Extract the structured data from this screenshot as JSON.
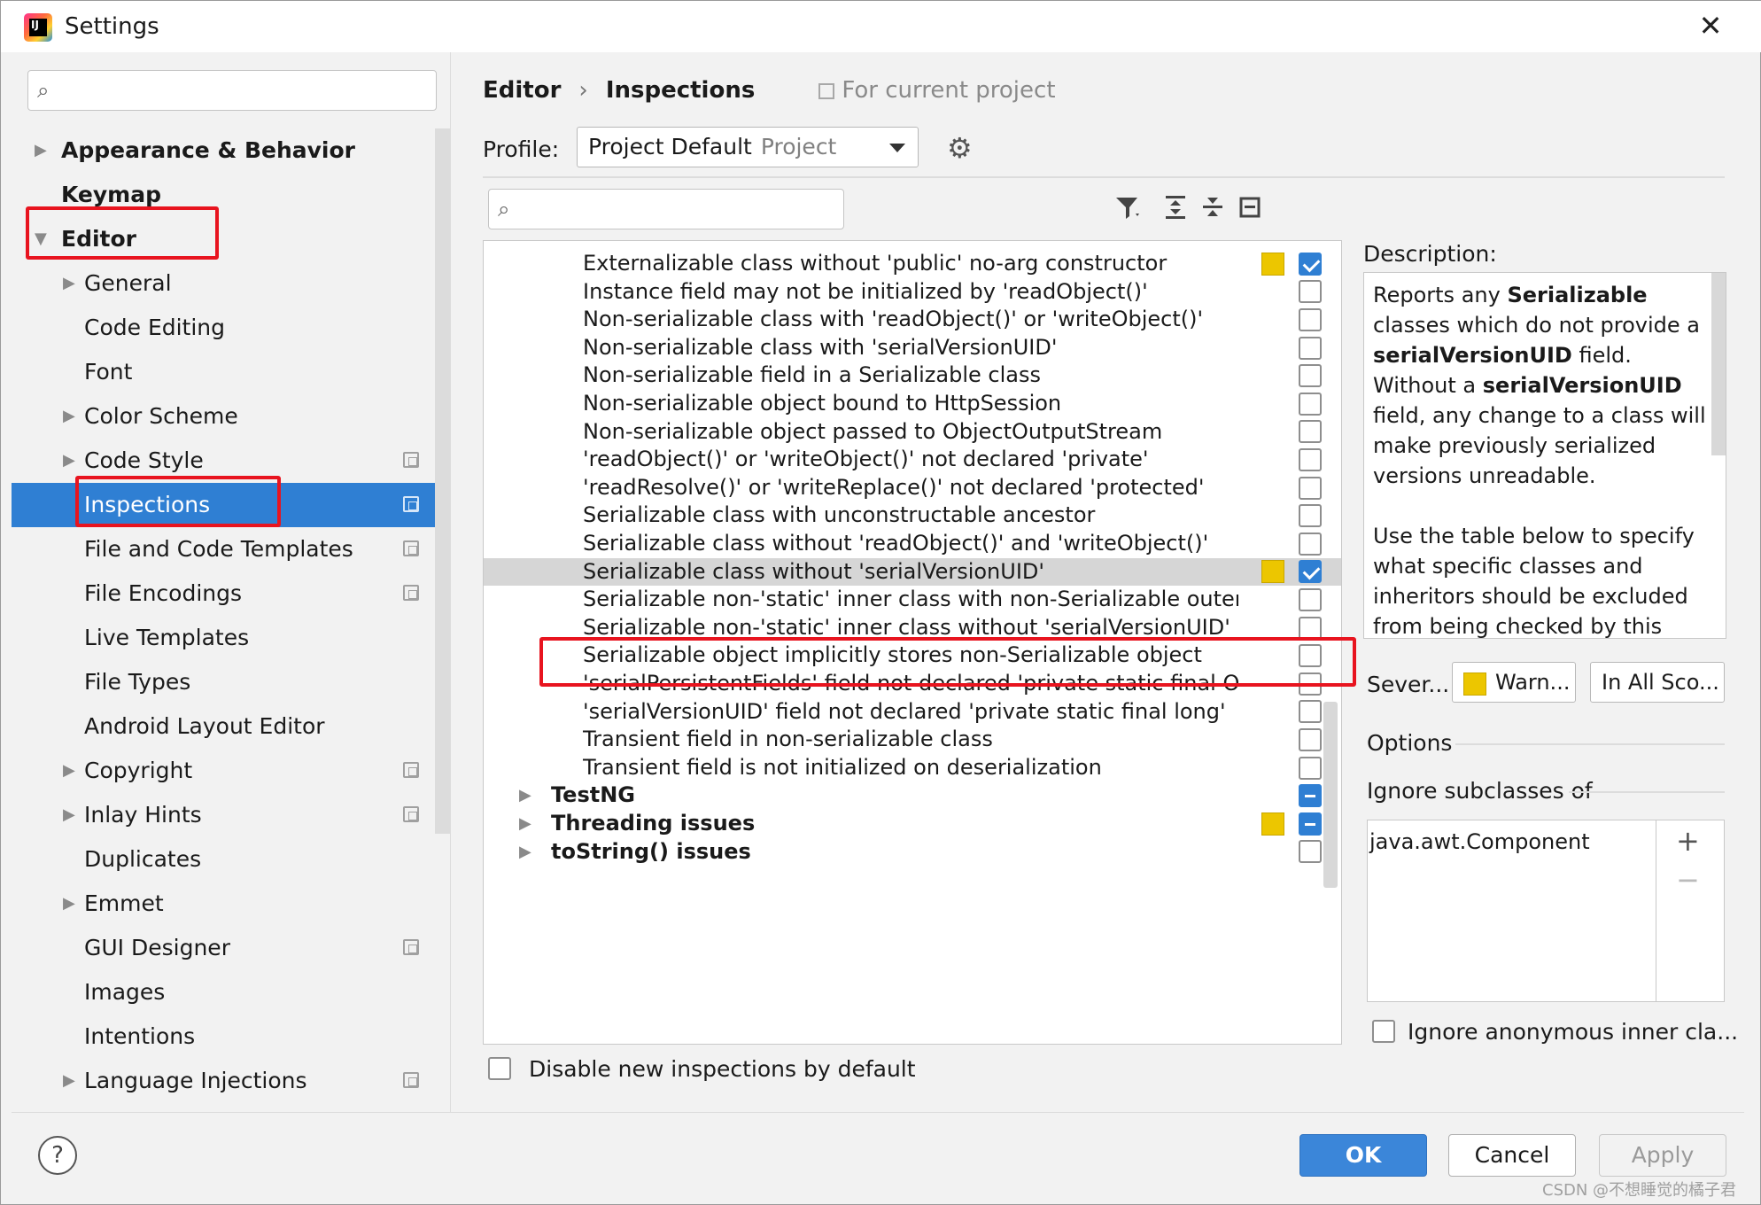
{
  "window": {
    "title": "Settings",
    "close_glyph": "✕"
  },
  "sidebar": {
    "search_placeholder": "",
    "items": [
      {
        "label": "Appearance & Behavior",
        "bold": true,
        "arrow": "▶"
      },
      {
        "label": "Keymap",
        "bold": true,
        "arrow": ""
      },
      {
        "label": "Editor",
        "bold": true,
        "arrow": "▼"
      },
      {
        "label": "General",
        "arrow": "▶"
      },
      {
        "label": "Code Editing",
        "arrow": ""
      },
      {
        "label": "Font",
        "arrow": ""
      },
      {
        "label": "Color Scheme",
        "arrow": "▶"
      },
      {
        "label": "Code Style",
        "arrow": "▶",
        "project": true
      },
      {
        "label": "Inspections",
        "arrow": "",
        "project": true,
        "selected": true
      },
      {
        "label": "File and Code Templates",
        "arrow": "",
        "project": true
      },
      {
        "label": "File Encodings",
        "arrow": "",
        "project": true
      },
      {
        "label": "Live Templates",
        "arrow": ""
      },
      {
        "label": "File Types",
        "arrow": ""
      },
      {
        "label": "Android Layout Editor",
        "arrow": ""
      },
      {
        "label": "Copyright",
        "arrow": "▶",
        "project": true
      },
      {
        "label": "Inlay Hints",
        "arrow": "▶",
        "project": true
      },
      {
        "label": "Duplicates",
        "arrow": ""
      },
      {
        "label": "Emmet",
        "arrow": "▶"
      },
      {
        "label": "GUI Designer",
        "arrow": "",
        "project": true
      },
      {
        "label": "Images",
        "arrow": ""
      },
      {
        "label": "Intentions",
        "arrow": ""
      },
      {
        "label": "Language Injections",
        "arrow": "▶",
        "project": true
      }
    ]
  },
  "main": {
    "breadcrumb": {
      "first": "Editor",
      "separator": "›",
      "second": "Inspections",
      "scope": "For current project"
    },
    "profile": {
      "label": "Profile:",
      "value": "Project Default",
      "sub": "Project"
    },
    "search_placeholder": "",
    "inspections": [
      {
        "label": "Externalizable class without 'public' no-arg constructor",
        "sev": true,
        "state": "on"
      },
      {
        "label": "Instance field may not be initialized by 'readObject()'",
        "state": "off"
      },
      {
        "label": "Non-serializable class with 'readObject()' or 'writeObject()'",
        "state": "off"
      },
      {
        "label": "Non-serializable class with 'serialVersionUID'",
        "state": "off"
      },
      {
        "label": "Non-serializable field in a Serializable class",
        "state": "off"
      },
      {
        "label": "Non-serializable object bound to HttpSession",
        "state": "off"
      },
      {
        "label": "Non-serializable object passed to ObjectOutputStream",
        "state": "off"
      },
      {
        "label": "'readObject()' or 'writeObject()' not declared 'private'",
        "state": "off"
      },
      {
        "label": "'readResolve()' or 'writeReplace()' not declared 'protected'",
        "state": "off"
      },
      {
        "label": "Serializable class with unconstructable ancestor",
        "state": "off"
      },
      {
        "label": "Serializable class without 'readObject()' and 'writeObject()'",
        "state": "off"
      },
      {
        "label": "Serializable class without 'serialVersionUID'",
        "sev": true,
        "state": "on",
        "highlight": true
      },
      {
        "label": "Serializable non-'static' inner class with non-Serializable outer class",
        "state": "off"
      },
      {
        "label": "Serializable non-'static' inner class without 'serialVersionUID'",
        "state": "off"
      },
      {
        "label": "Serializable object implicitly stores non-Serializable object",
        "state": "off"
      },
      {
        "label": "'serialPersistentFields' field not declared 'private static final ObjectStreamField[]'",
        "state": "off"
      },
      {
        "label": "'serialVersionUID' field not declared 'private static final long'",
        "state": "off"
      },
      {
        "label": "Transient field in non-serializable class",
        "state": "off"
      },
      {
        "label": "Transient field is not initialized on deserialization",
        "state": "off"
      },
      {
        "label": "TestNG",
        "group": true,
        "state": "mixed"
      },
      {
        "label": "Threading issues",
        "group": true,
        "sev": true,
        "state": "mixed"
      },
      {
        "label": "toString() issues",
        "group": true,
        "state": "off"
      }
    ],
    "disable_new_label": "Disable new inspections by default",
    "description_label": "Description:",
    "description": {
      "p1_a": "Reports any ",
      "p1_b": "Serializable",
      "p1_c": " classes which do not provide a ",
      "p1_d": "serialVersionUID",
      "p1_e": " field. Without a ",
      "p1_f": "serialVersionUID",
      "p1_g": " field, any change to a class will make previously serialized versions unreadable.",
      "p2": "Use the table below to specify what specific classes and inheritors should be excluded from being checked by this"
    },
    "severity_label": "Sever...",
    "severity_value": "Warn...",
    "scope_value": "In All Sco...",
    "options_label": "Options",
    "ignore_label": "Ignore subclasses of",
    "ignore_items": [
      "java.awt.Component"
    ],
    "anon_label": "Ignore anonymous inner cla..."
  },
  "buttons": {
    "help": "?",
    "ok": "OK",
    "cancel": "Cancel",
    "apply": "Apply"
  },
  "colors": {
    "accent": "#2f7fd3",
    "warning": "#ecc600",
    "highlight_border": "#e8141f"
  },
  "watermark": "CSDN @不想睡觉的橘子君"
}
